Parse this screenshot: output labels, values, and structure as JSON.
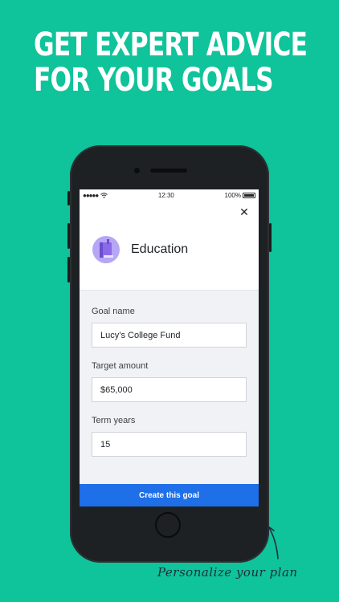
{
  "headline": {
    "line1": "GET EXPERT ADVICE",
    "line2": "FOR YOUR GOALS"
  },
  "status_bar": {
    "signal": "●●●●●",
    "time": "12:30",
    "battery": "100%"
  },
  "goal": {
    "title": "Education",
    "icon": "book-icon",
    "icon_color": "#8b6ae8"
  },
  "form": {
    "goal_name_label": "Goal name",
    "goal_name_value": "Lucy’s College Fund",
    "target_amount_label": "Target amount",
    "target_amount_value": "$65,000",
    "term_years_label": "Term years",
    "term_years_value": "15"
  },
  "cta": {
    "label": "Create this goal",
    "color": "#1e6fe8"
  },
  "tagline": "Personalize your plan",
  "background_color": "#0fc39a"
}
